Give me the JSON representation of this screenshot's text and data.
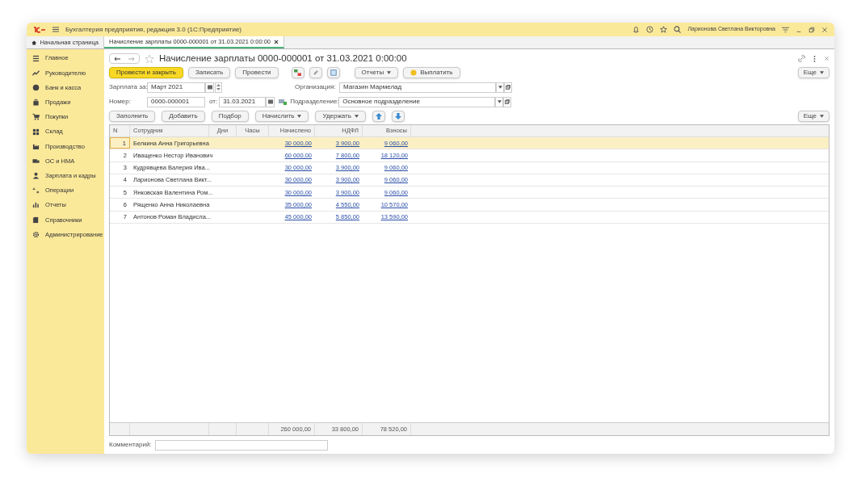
{
  "window": {
    "title": "Бухгалтерия предприятия, редакция 3.0  (1С:Предприятие)",
    "user": "Ларионова Светлана Викторовна"
  },
  "tabs": [
    {
      "label": "Начальная страница",
      "selected": false,
      "closable": false
    },
    {
      "label": "Начисление зарплаты 0000-000001 от 31.03.2021 0:00:00",
      "selected": true,
      "closable": true
    }
  ],
  "sidebar": {
    "items": [
      {
        "label": "Главное"
      },
      {
        "label": "Руководителю"
      },
      {
        "label": "Банк и касса"
      },
      {
        "label": "Продажи"
      },
      {
        "label": "Покупки"
      },
      {
        "label": "Склад"
      },
      {
        "label": "Производство"
      },
      {
        "label": "ОС и НМА"
      },
      {
        "label": "Зарплата и кадры"
      },
      {
        "label": "Операции"
      },
      {
        "label": "Отчеты"
      },
      {
        "label": "Справочники"
      },
      {
        "label": "Администрирование"
      }
    ]
  },
  "document": {
    "title": "Начисление зарплаты 0000-000001 от 31.03.2021 0:00:00",
    "toolbar": [
      {
        "kind": "primary",
        "label": "Провести и закрыть"
      },
      {
        "kind": "plain",
        "label": "Записать"
      },
      {
        "kind": "plain",
        "label": "Провести"
      },
      {
        "kind": "dropdown",
        "label": "Отчеты"
      },
      {
        "kind": "pay",
        "label": "Выплатить"
      }
    ],
    "more": "Еще",
    "fields": {
      "period_label": "Зарплата за:",
      "period": "Март 2021",
      "organization_label": "Организация:",
      "organization": "Магазин Мармелад",
      "number_label": "Номер:",
      "number": "0000-000001",
      "date_label": "от:",
      "date": "31.03.2021",
      "department_label": "Подразделение:",
      "department": "Основное подразделение"
    },
    "table_toolbar": [
      {
        "kind": "plain",
        "label": "Заполнить"
      },
      {
        "kind": "plain",
        "label": "Добавить"
      },
      {
        "kind": "plain",
        "label": "Подбор"
      },
      {
        "kind": "dropdown",
        "label": "Начислить"
      },
      {
        "kind": "dropdown",
        "label": "Удержать"
      }
    ],
    "table_more": "Еще",
    "table": {
      "columns": [
        "N",
        "Сотрудник",
        "Дни",
        "Часы",
        "Начислено",
        "НДФЛ",
        "Взносы"
      ],
      "rows": [
        {
          "n": "1",
          "employee": "Белкина Анна Григорьевна",
          "accrued": "30 000,00",
          "ndfl": "3 900,00",
          "contributions": "9 060,00",
          "selected": true
        },
        {
          "n": "2",
          "employee": "Иващенко Нестор Иванович",
          "accrued": "60 000,00",
          "ndfl": "7 800,00",
          "contributions": "18 120,00",
          "selected": false
        },
        {
          "n": "3",
          "employee": "Кудрявцева Валерия Ива...",
          "accrued": "30 000,00",
          "ndfl": "3 900,00",
          "contributions": "9 060,00",
          "selected": false
        },
        {
          "n": "4",
          "employee": "Ларионова Светлана Викт...",
          "accrued": "30 000,00",
          "ndfl": "3 900,00",
          "contributions": "9 060,00",
          "selected": false
        },
        {
          "n": "5",
          "employee": "Янковская Валентина Ром...",
          "accrued": "30 000,00",
          "ndfl": "3 900,00",
          "contributions": "9 060,00",
          "selected": false
        },
        {
          "n": "6",
          "employee": "Рященко Анна Николаевна",
          "accrued": "35 000,00",
          "ndfl": "4 550,00",
          "contributions": "10 570,00",
          "selected": false
        },
        {
          "n": "7",
          "employee": "Антонов Роман Владисла...",
          "accrued": "45 000,00",
          "ndfl": "5 850,00",
          "contributions": "13 590,00",
          "selected": false
        }
      ],
      "totals": {
        "accrued": "260 000,00",
        "ndfl": "33 800,00",
        "contributions": "78 520,00"
      }
    },
    "comment_label": "Комментарий:"
  }
}
